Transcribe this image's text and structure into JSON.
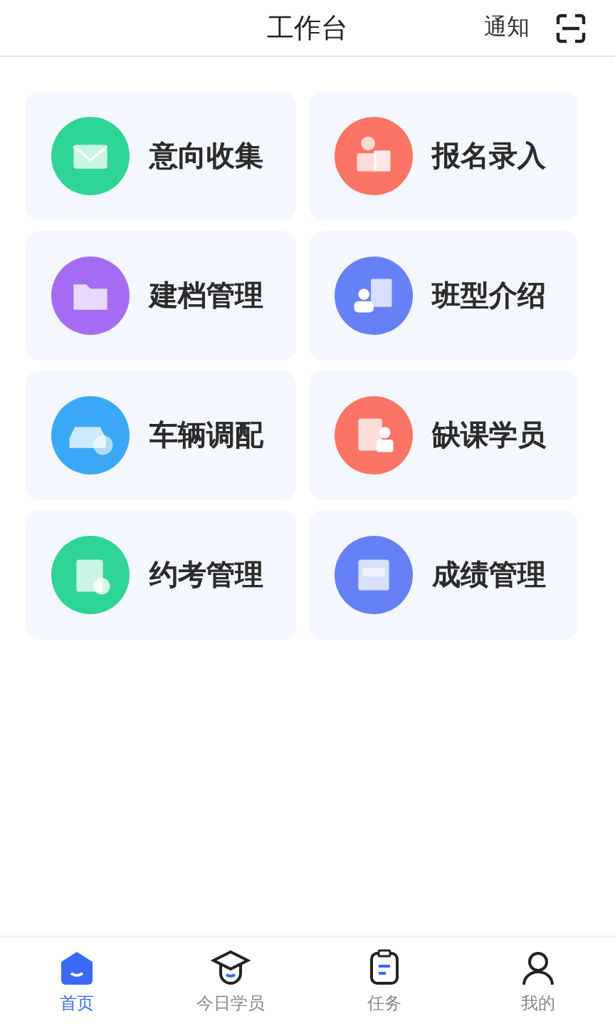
{
  "header": {
    "title": "工作台",
    "notice": "通知"
  },
  "tiles": [
    {
      "label": "意向收集",
      "kind": "envelope",
      "color": "#2fd596"
    },
    {
      "label": "报名录入",
      "kind": "signup",
      "color": "#fb7466"
    },
    {
      "label": "建档管理",
      "kind": "folder",
      "color": "#a56cf3"
    },
    {
      "label": "班型介绍",
      "kind": "teacher",
      "color": "#6680f6"
    },
    {
      "label": "车辆调配",
      "kind": "car",
      "color": "#3aa8f6"
    },
    {
      "label": "缺课学员",
      "kind": "absent",
      "color": "#fb7466"
    },
    {
      "label": "约考管理",
      "kind": "clipboard",
      "color": "#2fd596"
    },
    {
      "label": "成绩管理",
      "kind": "score",
      "color": "#6680f6"
    }
  ],
  "tabbar": [
    {
      "label": "首页",
      "kind": "home",
      "selected": true
    },
    {
      "label": "今日学员",
      "kind": "student",
      "selected": false
    },
    {
      "label": "任务",
      "kind": "task",
      "selected": false
    },
    {
      "label": "我的",
      "kind": "me",
      "selected": false
    }
  ]
}
